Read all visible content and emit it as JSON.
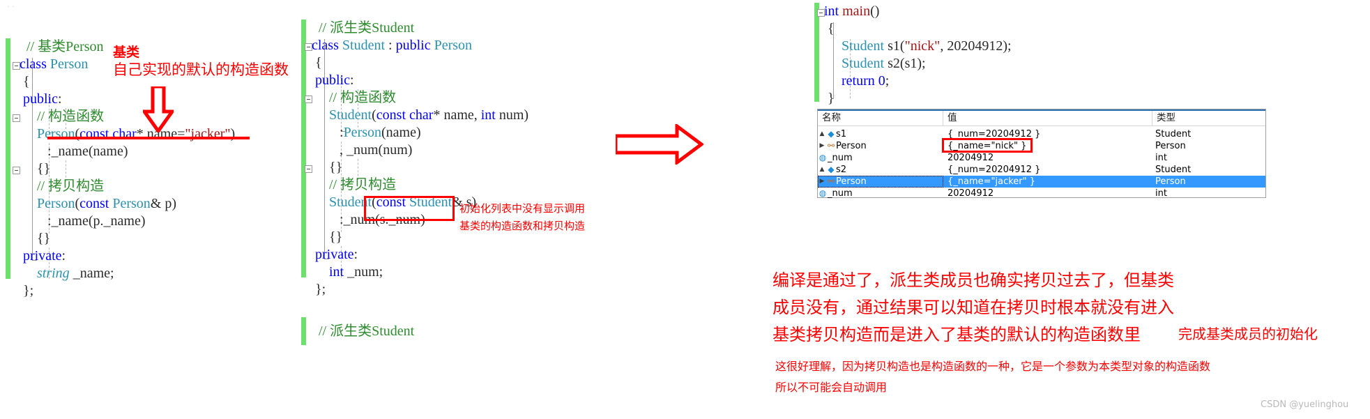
{
  "panels": {
    "base_class": {
      "gutter_color": "#6ee06e",
      "lines": [
        "// 基类Person",
        "class Person",
        "{",
        "public:",
        "    // 构造函数",
        "    Person(const char* name=\"jacker\")",
        "        :_name(name)",
        "    {}",
        "    // 拷贝构造",
        "    Person(const Person& p)",
        "        :_name(p._name)",
        "    {}",
        "private:",
        "    string _name;",
        "};"
      ]
    },
    "derived_class": {
      "gutter_color": "#6ee06e",
      "lines": [
        "// 派生类Student",
        "class Student : public Person",
        "{",
        "public:",
        "    // 构造函数",
        "    Student(const char* name, int num)",
        "        :Person(name)",
        "        , _num(num)",
        "    {}",
        "    // 拷贝构造",
        "    Student(const Student& s)",
        "        :_num(s._num)",
        "    {}",
        "private:",
        "    int _num;",
        "};"
      ]
    },
    "main_fn": {
      "gutter_color": "#6ee06e",
      "lines": [
        "int main()",
        "{",
        "    Student s1(\"nick\", 20204912);",
        "    Student s2(s1);",
        "    return 0;",
        "}"
      ]
    },
    "bottom_partial": {
      "lines": [
        "// 派生类Student"
      ]
    }
  },
  "annotations": {
    "base_label": "基类",
    "base_desc": "自己实现的默认的构造函数",
    "init_note_line1": "初始化列表中没有显示调用",
    "init_note_line2": "基类的构造函数和拷贝构造",
    "conclusion": {
      "line1": "编译是通过了，派生类成员也确实拷贝过去了，但基类",
      "line2": "成员没有，通过结果可以知道在拷贝时根本就没有进入",
      "line3a": "基类拷贝构造而是进入了基类的默认的构造函数里",
      "line3b": "完成基类成员的初始化"
    },
    "footnote": {
      "line1": "这很好理解，因为拷贝构造也是构造函数的一种，它是一个参数为本类型对象的构造函数",
      "line2": "所以不可能会自动调用"
    },
    "red_color": "#ff0000"
  },
  "watch_window": {
    "columns": [
      "名称",
      "值",
      "类型"
    ],
    "rows": [
      {
        "expander": "▲",
        "icon": "cube-icon",
        "indent": 1,
        "name": "s1",
        "value": "{_num=20204912 }",
        "type": "Student",
        "selected": false,
        "highlight_value": false
      },
      {
        "expander": "▶",
        "icon": "link-icon",
        "indent": 2,
        "name": "Person",
        "value": "{_name=\"nick\" }",
        "type": "Person",
        "selected": false,
        "highlight_value": true
      },
      {
        "expander": "",
        "icon": "lock-icon",
        "indent": 3,
        "name": "_num",
        "value": "20204912",
        "type": "int",
        "selected": false,
        "highlight_value": false
      },
      {
        "expander": "▲",
        "icon": "cube-icon",
        "indent": 1,
        "name": "s2",
        "value": "{_num=20204912 }",
        "type": "Student",
        "selected": false,
        "highlight_value": false
      },
      {
        "expander": "▶",
        "icon": "link-icon",
        "indent": 2,
        "name": "Person",
        "value": "{_name=\"jacker\" }",
        "type": "Person",
        "selected": true,
        "highlight_value": false
      },
      {
        "expander": "",
        "icon": "lock-icon",
        "indent": 3,
        "name": "_num",
        "value": "20204912",
        "type": "int",
        "selected": false,
        "highlight_value": false
      }
    ]
  },
  "watermark": "CSDN @yuelinghou"
}
